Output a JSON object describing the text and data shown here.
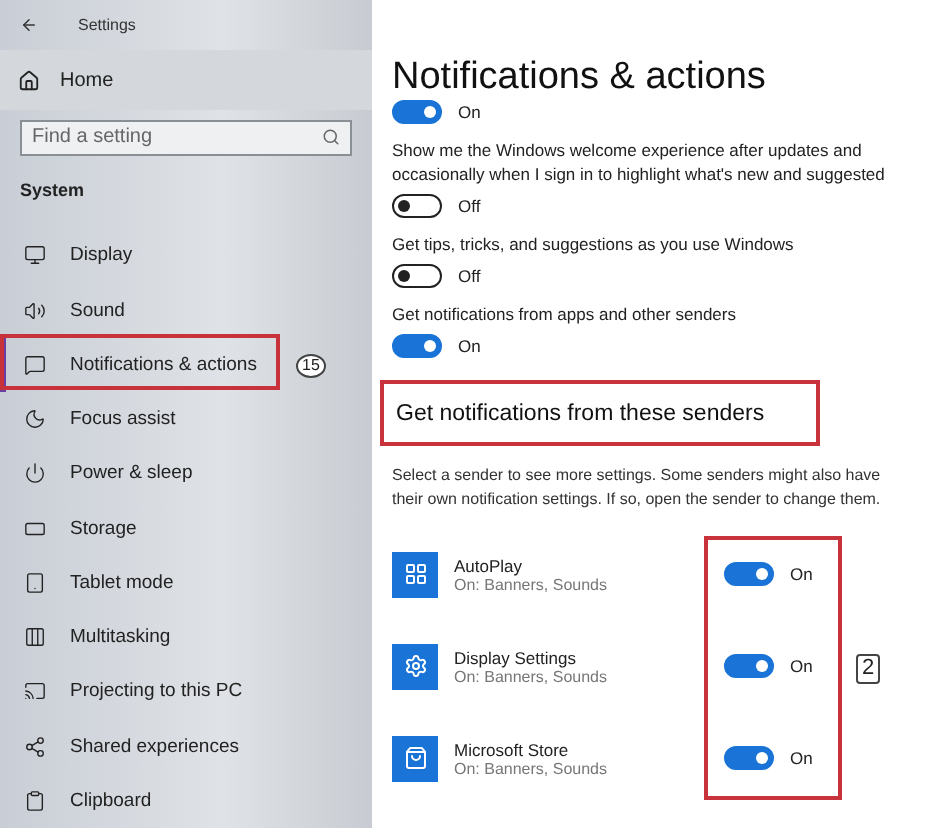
{
  "window": {
    "title": "Settings"
  },
  "sidebar": {
    "home": "Home",
    "search": {
      "placeholder": "Find a setting"
    },
    "section": "System",
    "items": [
      {
        "label": "Display",
        "selected": false
      },
      {
        "label": "Sound",
        "selected": false
      },
      {
        "label": "Notifications & actions",
        "selected": true,
        "annotation": "15"
      },
      {
        "label": "Focus assist",
        "selected": false
      },
      {
        "label": "Power & sleep",
        "selected": false
      },
      {
        "label": "Storage",
        "selected": false
      },
      {
        "label": "Tablet mode",
        "selected": false
      },
      {
        "label": "Multitasking",
        "selected": false
      },
      {
        "label": "Projecting to this PC",
        "selected": false
      },
      {
        "label": "Shared experiences",
        "selected": false
      },
      {
        "label": "Clipboard",
        "selected": false
      }
    ]
  },
  "main": {
    "title": "Notifications & actions",
    "settings": [
      {
        "on": true,
        "state_label": "On"
      },
      {
        "label": "Show me the Windows welcome experience after updates and occasionally when I sign in to highlight what's new and suggested",
        "on": false,
        "state_label": "Off"
      },
      {
        "label": "Get tips, tricks, and suggestions as you use Windows",
        "on": false,
        "state_label": "Off"
      },
      {
        "label": "Get notifications from apps and other senders",
        "on": true,
        "state_label": "On"
      }
    ],
    "senders_heading": "Get notifications from these senders",
    "senders_description": "Select a sender to see more settings. Some senders might also have their own notification settings. If so, open the sender to change them.",
    "senders_annotation": "2",
    "senders": [
      {
        "name": "AutoPlay",
        "detail": "On: Banners, Sounds",
        "on": true,
        "state_label": "On"
      },
      {
        "name": "Display Settings",
        "detail": "On: Banners, Sounds",
        "on": true,
        "state_label": "On"
      },
      {
        "name": "Microsoft Store",
        "detail": "On: Banners, Sounds",
        "on": true,
        "state_label": "On"
      }
    ]
  }
}
